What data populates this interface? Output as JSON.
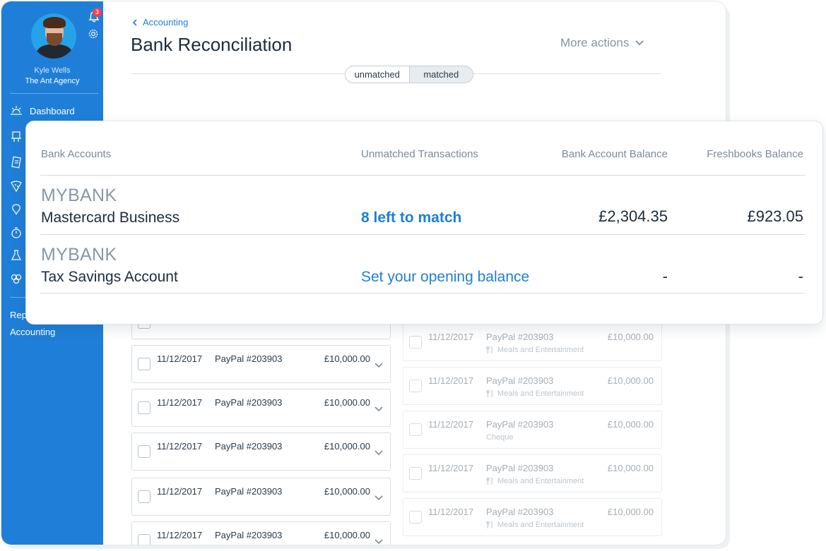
{
  "sidebar": {
    "user_name": "Kyle Wells",
    "company": "The Ant Agency",
    "notification_count": "3",
    "nav": {
      "dashboard": "Dashboard",
      "reports": "Rep",
      "accounting": "Accounting"
    }
  },
  "header": {
    "breadcrumb": "Accounting",
    "title": "Bank Reconciliation",
    "more_actions": "More actions",
    "toggle": {
      "unmatched": "unmatched",
      "matched": "matched"
    }
  },
  "left_transactions": [
    {
      "date": "11/12/2017",
      "desc": "PayPal #203903",
      "amount": "£10,000.00"
    },
    {
      "date": "11/12/2017",
      "desc": "PayPal #203903",
      "amount": "£10,000.00"
    },
    {
      "date": "11/12/2017",
      "desc": "PayPal #203903",
      "amount": "£10,000.00"
    },
    {
      "date": "11/12/2017",
      "desc": "PayPal #203903",
      "amount": "£10,000.00"
    },
    {
      "date": "11/12/2017",
      "desc": "PayPal #203903",
      "amount": "£10,000.00"
    }
  ],
  "right_transactions": [
    {
      "date": "11/12/2017",
      "desc": "PayPal #203903",
      "amount": "£10,000.00",
      "category": "Meals and Entertainment",
      "icon": "fork-knife-icon"
    },
    {
      "date": "11/12/2017",
      "desc": "PayPal #203903",
      "amount": "£10,000.00",
      "category": "Meals and Entertainment",
      "icon": "fork-knife-icon"
    },
    {
      "date": "11/12/2017",
      "desc": "PayPal #203903",
      "amount": "£10,000.00",
      "category": "Cheque",
      "icon": ""
    },
    {
      "date": "11/12/2017",
      "desc": "PayPal #203903",
      "amount": "£10,000.00",
      "category": "Meals and Entertainment",
      "icon": "fork-knife-icon"
    },
    {
      "date": "11/12/2017",
      "desc": "PayPal #203903",
      "amount": "£10,000.00",
      "category": "Meals and Entertainment",
      "icon": "fork-knife-icon"
    }
  ],
  "accounts_card": {
    "headers": {
      "bank_accounts": "Bank Accounts",
      "unmatched": "Unmatched Transactions",
      "bank_balance": "Bank Account Balance",
      "freshbooks_balance": "Freshbooks Balance"
    },
    "rows": [
      {
        "bank": "MYBANK",
        "account": "Mastercard Business",
        "unmatched": "8 left to match",
        "bank_balance": "£2,304.35",
        "freshbooks_balance": "£923.05"
      },
      {
        "bank": "MYBANK",
        "account": "Tax Savings Account",
        "unmatched": "Set your opening balance",
        "bank_balance": "-",
        "freshbooks_balance": "-"
      }
    ]
  },
  "colors": {
    "sidebar": "#1f7fd8",
    "link": "#1f7fd8",
    "badge": "#f0404f"
  }
}
